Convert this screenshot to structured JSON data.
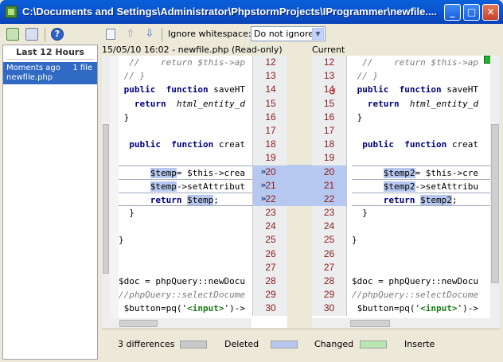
{
  "window": {
    "title": "C:\\Documents and Settings\\Administrator\\PhpstormProjects\\IProgrammer\\newfile....",
    "min_glyph": "_",
    "max_glyph": "□",
    "close_glyph": "✕"
  },
  "left_toolbar": {
    "help_glyph": "?"
  },
  "history": {
    "header": "Last 12 Hours",
    "items": [
      {
        "time": "Moments ago",
        "count": "1 file",
        "file": "newfile.php"
      }
    ]
  },
  "diff_toolbar": {
    "ignore_label": "Ignore whitespace:",
    "ignore_value": "Do not ignore",
    "up_glyph": "⇧",
    "down_glyph": "⇩",
    "select_arrow": "▼"
  },
  "left_pane": {
    "header": "15/05/10 16:02 - newfile.php (Read-only)",
    "line_numbers": [
      "12",
      "13",
      "14",
      "15",
      "16",
      "17",
      "18",
      "19",
      "20",
      "21",
      "22",
      "23",
      "24",
      "25",
      "26",
      "27",
      "28",
      "29",
      "30"
    ],
    "lines": [
      "  //    return $this->ap",
      " // }",
      " public  function saveHT",
      "   return  html_entity_d",
      " }",
      "",
      "  public  function creat",
      "",
      "      $temp= $this->crea",
      "      $temp->setAttribut",
      "      return $temp;",
      "  }",
      "",
      "}",
      "",
      "",
      "$doc = phpQuery::newDocu",
      "//phpQuery::selectDocume",
      " $button=pq('<input>')->"
    ],
    "merge_glyph": "»"
  },
  "right_pane": {
    "header": "Current",
    "line_numbers": [
      "12",
      "13",
      "14",
      "15",
      "16",
      "17",
      "18",
      "19",
      "20",
      "21",
      "22",
      "23",
      "24",
      "25",
      "26",
      "27",
      "28",
      "29",
      "30"
    ],
    "lines": [
      "  //    return $this->ap",
      " // }",
      " public  function saveHT",
      "   return  html_entity_d",
      " }",
      "",
      "  public  function creat",
      "",
      "      $temp2= $this->cre",
      "      $temp2->setAttribu",
      "      return $temp2;",
      "  }",
      "",
      "}",
      "",
      "",
      "$doc = phpQuery::newDocu",
      "//phpQuery::selectDocume",
      " $button=pq('<input>')->"
    ]
  },
  "status": {
    "count": "3 differences",
    "legend": [
      {
        "label": "Deleted",
        "color": "#c8c8c8"
      },
      {
        "label": "Changed",
        "color": "#b6c8ef"
      },
      {
        "label": "Inserte",
        "color": "#b8e6b0"
      }
    ]
  },
  "colors": {
    "changed": "#b6c8ef",
    "line_number": "#8b1a1a",
    "keyword": "#000080",
    "selection": "#316ac5"
  }
}
